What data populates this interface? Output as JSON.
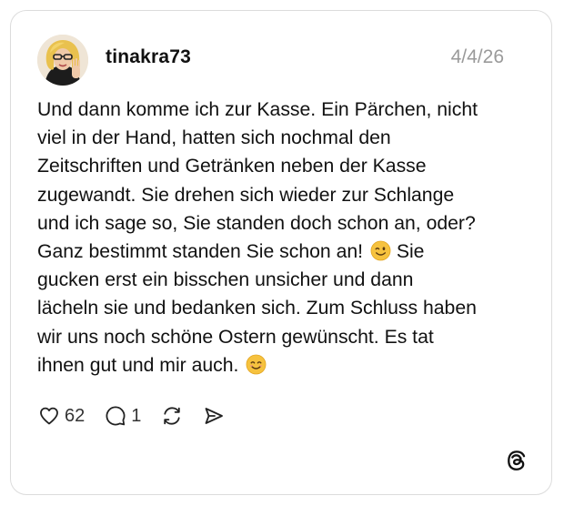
{
  "post": {
    "username": "tinakra73",
    "date": "4/4/26",
    "text_lines": [
      "Und dann komme ich zur Kasse. Ein Pärchen, nicht",
      "viel in der Hand, hatten sich nochmal den",
      "Zeitschriften und Getränken neben der Kasse",
      "zugewandt. Sie drehen sich wieder zur Schlange",
      "und ich sage so, Sie standen doch schon an, oder?",
      "Ganz bestimmt standen Sie schon an!",
      "Sie",
      "gucken erst ein bisschen unsicher und dann",
      "lächeln sie und bedanken sich. Zum Schluss haben",
      "wir uns noch schöne Ostern gewünscht. Es tat",
      "ihnen gut und mir auch."
    ],
    "emojis": [
      "winking-face-emoji",
      "smiling-face-emoji"
    ]
  },
  "actions": {
    "likes": "62",
    "replies": "1"
  },
  "icons": {
    "like": "heart-icon",
    "reply": "comment-bubble-icon",
    "repost": "repost-icon",
    "share": "send-icon",
    "brand": "threads-logo-icon"
  },
  "colors": {
    "text": "#111111",
    "muted": "#9a9a9a",
    "border": "#dcdcdc"
  }
}
